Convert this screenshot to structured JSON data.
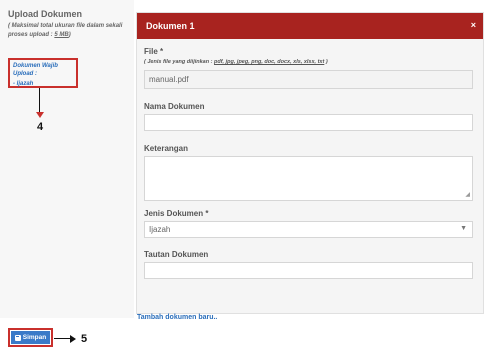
{
  "left": {
    "title": "Upload Dokumen",
    "note_line1": "( Maksimal total ukuran file dalam sekali",
    "note_line2_prefix": "proses upload : ",
    "note_size": "5 MB",
    "note_suffix": ")",
    "required_title": "Dokumen Wajib Upload :",
    "required_items": [
      "- Ijazah"
    ],
    "marker": "4"
  },
  "modal": {
    "title": "Dokumen 1",
    "close": "×",
    "file_label": "File *",
    "file_hint_prefix": "( Jenis file yang diijinkan : ",
    "file_types": "pdf, jpg, jpeg, png, doc, docx, xls, xlsx, txt",
    "file_hint_suffix": " )",
    "file_value": "manual.pdf",
    "name_label": "Nama Dokumen",
    "name_value": "",
    "desc_label": "Keterangan",
    "type_label": "Jenis Dokumen *",
    "type_value": "Ijazah",
    "link_label": "Tautan Dokumen",
    "link_value": ""
  },
  "add_link": "Tambah dokumen baru..",
  "save": {
    "label": "Simpan",
    "marker": "5"
  }
}
